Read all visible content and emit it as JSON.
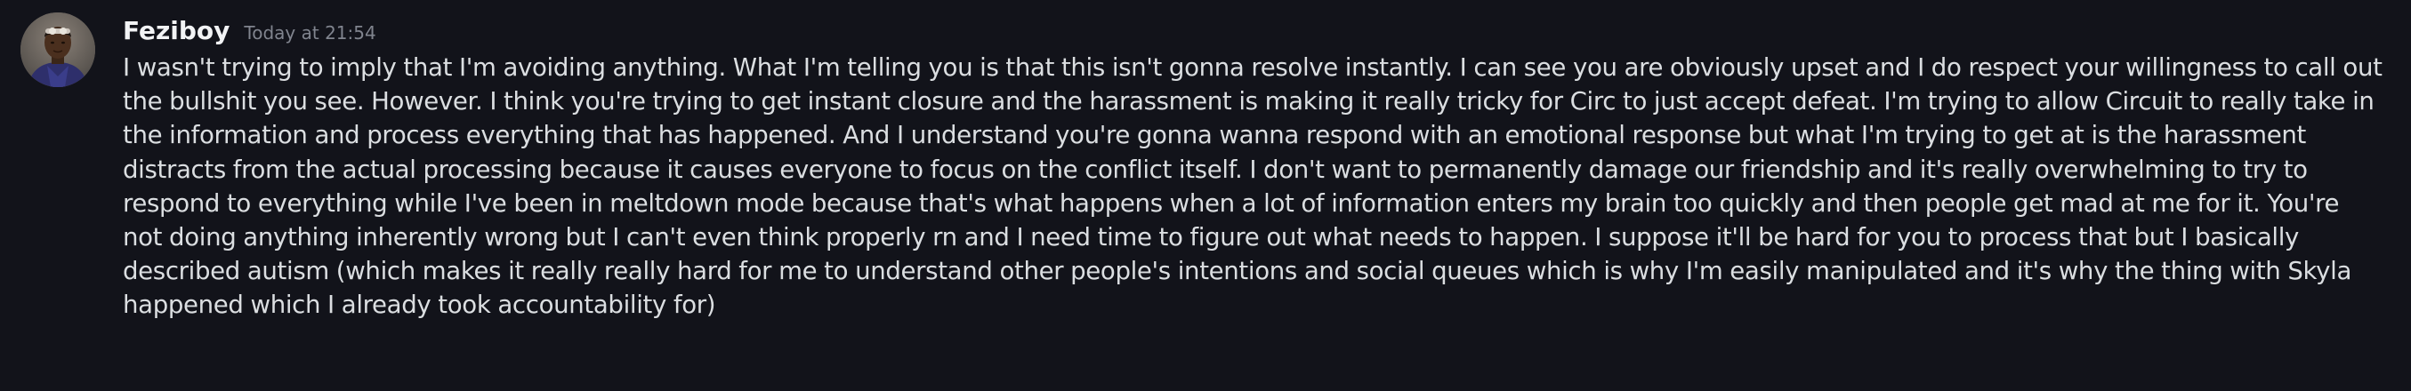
{
  "message": {
    "author": "Feziboy",
    "timestamp": "Today at 21:54",
    "avatar_icon": "user-avatar",
    "text": "I wasn't trying to imply that I'm avoiding anything. What I'm telling you is that this isn't gonna resolve instantly. I can see you are obviously upset and I do respect your willingness to call out the bullshit you see. However. I think you're trying to get instant closure and the harassment is making it really tricky for Circ to just accept defeat. I'm trying to allow Circuit to really take in the information and process everything that has happened. And I understand you're gonna wanna respond with an emotional response but what I'm trying to get at is the harassment distracts from the actual processing because it causes everyone to focus on the conflict itself. I don't want to permanently damage our friendship and it's really overwhelming to try to respond to everything while I've been in meltdown mode because that's what happens when a lot of information enters my brain too quickly and then people get mad at me for it. You're not doing anything inherently wrong but I can't even think properly rn and I need time to figure out what needs to happen. I suppose it'll be hard for you to process that but I basically described autism (which makes it really really hard for me to understand other people's intentions and social queues which is why I'm easily manipulated and it's why the thing with Skyla happened which I already took accountability for)"
  },
  "colors": {
    "background": "#12131a",
    "author": "#f2f3f5",
    "timestamp": "#80848e",
    "body_text": "#dbdee1"
  }
}
